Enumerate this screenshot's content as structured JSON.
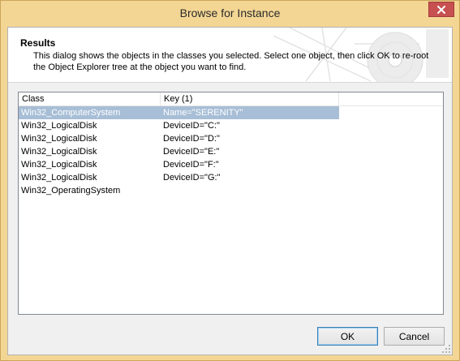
{
  "window": {
    "title": "Browse for Instance"
  },
  "header": {
    "title": "Results",
    "description": "This dialog shows the objects in the classes you selected.  Select one object, then click OK to re-root the Object Explorer tree at the object you want to find."
  },
  "list": {
    "columns": [
      "Class",
      "Key (1)"
    ],
    "rows": [
      {
        "class": "Win32_ComputerSystem",
        "key": "Name=\"SERENITY\"",
        "selected": true
      },
      {
        "class": "Win32_LogicalDisk",
        "key": "DeviceID=\"C:\""
      },
      {
        "class": "Win32_LogicalDisk",
        "key": "DeviceID=\"D:\""
      },
      {
        "class": "Win32_LogicalDisk",
        "key": "DeviceID=\"E:\""
      },
      {
        "class": "Win32_LogicalDisk",
        "key": "DeviceID=\"F:\""
      },
      {
        "class": "Win32_LogicalDisk",
        "key": "DeviceID=\"G:\""
      },
      {
        "class": "Win32_OperatingSystem",
        "key": ""
      }
    ]
  },
  "buttons": {
    "ok": "OK",
    "cancel": "Cancel"
  },
  "colors": {
    "titlebar": "#f4d694",
    "selection": "#a7bed6",
    "close": "#c75050"
  },
  "icons": {
    "close": "close-icon",
    "header_art": "cd-disc-icon",
    "grip": "size-grip-icon"
  }
}
